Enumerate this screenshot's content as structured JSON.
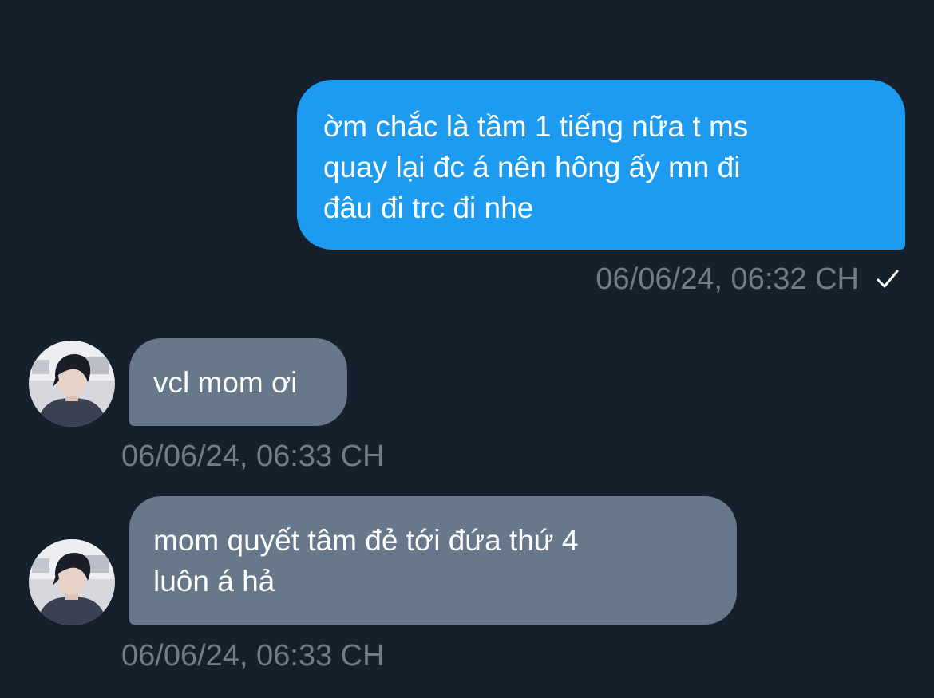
{
  "conversation": {
    "messages": [
      {
        "direction": "sent",
        "text": "ờm chắc là tầm 1 tiếng nữa t ms\nquay lại đc á nên hông ấy mn đi\nđâu đi trc đi nhe",
        "timestamp": "06/06/24, 06:32 CH",
        "status_icon": "check-icon"
      },
      {
        "direction": "received",
        "text": "vcl mom ơi",
        "timestamp": "06/06/24, 06:33 CH",
        "avatar_icon": "contact-avatar"
      },
      {
        "direction": "received",
        "text": "mom quyết tâm đẻ tới đứa thứ 4\nluôn á hả",
        "timestamp": "06/06/24, 06:33 CH",
        "avatar_icon": "contact-avatar"
      }
    ]
  },
  "colors": {
    "background": "#16202c",
    "sent_bubble": "#1d9bf0",
    "received_bubble": "#67788a",
    "timestamp": "#707c88",
    "text": "#ffffff"
  }
}
